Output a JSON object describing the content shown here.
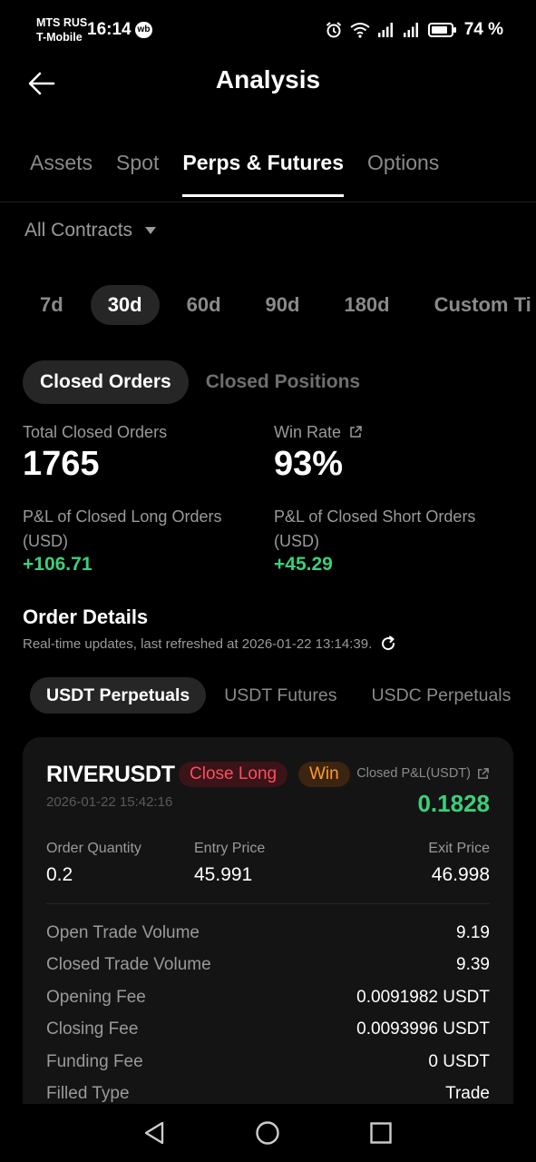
{
  "status_bar": {
    "carrier_1": "MTS RUS",
    "carrier_2": "T-Mobile",
    "time": "16:14",
    "app_badge": "wb",
    "battery": "74 %",
    "icons": [
      "alarm-icon",
      "wifi-icon",
      "signal-icon",
      "signal-icon",
      "battery-icon"
    ]
  },
  "header": {
    "title": "Analysis",
    "back_icon": "arrow-left-icon"
  },
  "tabs": [
    {
      "label": "Assets",
      "active": false
    },
    {
      "label": "Spot",
      "active": false
    },
    {
      "label": "Perps & Futures",
      "active": true
    },
    {
      "label": "Options",
      "active": false
    }
  ],
  "contract_filter": {
    "value": "All Contracts",
    "icon": "caret-down-icon"
  },
  "periods": [
    {
      "label": "7d",
      "active": false
    },
    {
      "label": "30d",
      "active": true
    },
    {
      "label": "60d",
      "active": false
    },
    {
      "label": "90d",
      "active": false
    },
    {
      "label": "180d",
      "active": false
    },
    {
      "label": "Custom Ti",
      "active": false
    }
  ],
  "segments": [
    {
      "label": "Closed Orders",
      "active": true
    },
    {
      "label": "Closed Positions",
      "active": false
    }
  ],
  "stats": {
    "total_closed_orders_label": "Total Closed Orders",
    "total_closed_orders": "1765",
    "win_rate_label": "Win Rate",
    "win_rate": "93%",
    "long_pnl_label_1": "P&L of Closed Long Orders",
    "long_pnl_label_2": "(USD)",
    "long_pnl": "+106.71",
    "short_pnl_label_1": "P&L of Closed Short Orders",
    "short_pnl_label_2": "(USD)",
    "short_pnl": "+45.29"
  },
  "order_details": {
    "title": "Order Details",
    "subtitle": "Real-time updates, last refreshed at 2026-01-22 13:14:39."
  },
  "subtabs": [
    {
      "label": "USDT Perpetuals",
      "active": true
    },
    {
      "label": "USDT Futures",
      "active": false
    },
    {
      "label": "USDC Perpetuals",
      "active": false
    }
  ],
  "order_card": {
    "symbol": "RIVERUSDT",
    "side_badge": "Close Long",
    "result_badge": "Win",
    "pnl_label": "Closed P&L(USDT)",
    "pnl_value": "0.1828",
    "timestamp": "2026-01-22 15:42:16",
    "order_quantity_label": "Order Quantity",
    "order_quantity": "0.2",
    "entry_price_label": "Entry Price",
    "entry_price": "45.991",
    "exit_price_label": "Exit Price",
    "exit_price": "46.998",
    "rows": [
      {
        "label": "Open Trade Volume",
        "value": "9.19"
      },
      {
        "label": "Closed Trade Volume",
        "value": "9.39"
      },
      {
        "label": "Opening Fee",
        "value": "0.0091982 USDT"
      },
      {
        "label": "Closing Fee",
        "value": "0.0093996 USDT"
      },
      {
        "label": "Funding Fee",
        "value": "0 USDT"
      },
      {
        "label": "Filled Type",
        "value": "Trade"
      }
    ]
  },
  "nav_bar": {
    "icons": [
      "back-triangle-icon",
      "home-circle-icon",
      "recents-square-icon"
    ]
  },
  "colors": {
    "background": "#000000",
    "positive": "#3ccf7a",
    "negative": "#ff4d5e",
    "warning": "#ff9a2e",
    "pill_bg": "#262626",
    "card_bg": "#141414"
  }
}
